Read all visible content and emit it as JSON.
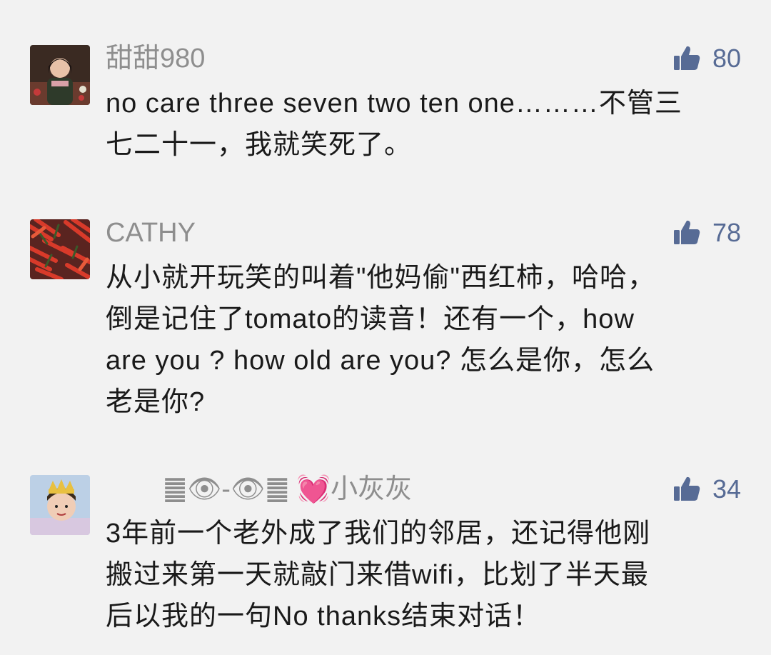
{
  "accent_color": "#576b95",
  "comments": [
    {
      "name": "甜甜980",
      "likes": "80",
      "lines": [
        "no care three seven two ten one………不管三",
        "七二十一，我就笑死了。"
      ]
    },
    {
      "name": "CATHY",
      "likes": "78",
      "lines": [
        "从小就开玩笑的叫着\"他妈偷\"西红柿，哈哈，",
        "倒是记住了tomato的读音！还有一个，how",
        "are you ? how old are you? 怎么是你，怎么",
        "老是你?"
      ]
    },
    {
      "name": "䷀👁‍-👁䷀ 💓小灰灰",
      "likes": "34",
      "lines": [
        "3年前一个老外成了我们的邻居，还记得他刚",
        "搬过来第一天就敲门来借wifi，比划了半天最",
        "后以我的一句No thanks结束对话！"
      ]
    }
  ]
}
